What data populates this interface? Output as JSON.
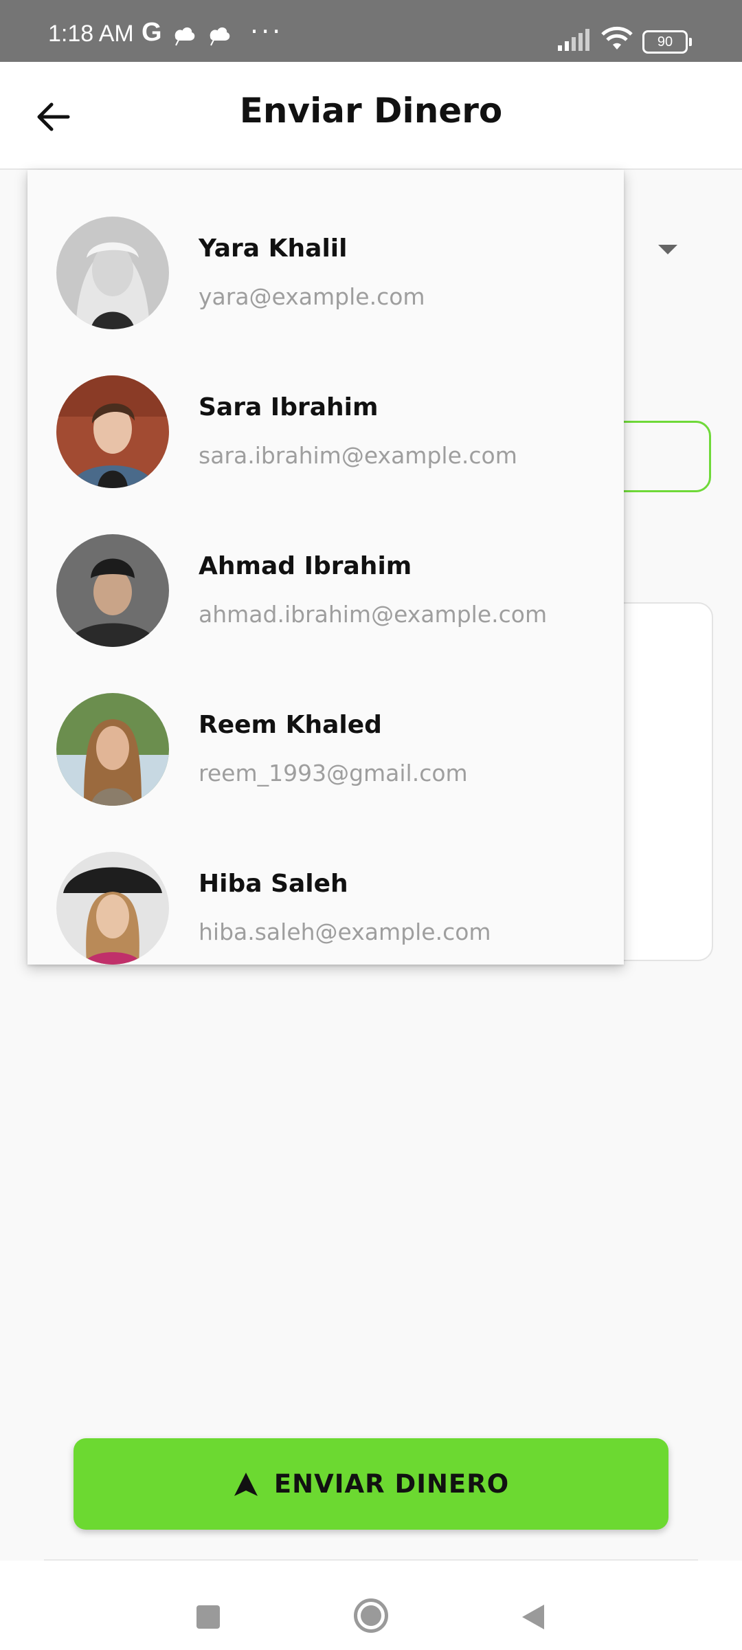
{
  "status_bar": {
    "time": "1:18 AM",
    "carrier_icon": "G",
    "more": "···",
    "battery": "90"
  },
  "app_bar": {
    "title": "Enviar Dinero",
    "back_icon": "arrow-left-icon"
  },
  "contacts": [
    {
      "name": "Yara Khalil",
      "email": "yara@example.com"
    },
    {
      "name": "Sara Ibrahim",
      "email": "sara.ibrahim@example.com"
    },
    {
      "name": "Ahmad Ibrahim",
      "email": "ahmad.ibrahim@example.com"
    },
    {
      "name": "Reem Khaled",
      "email": "reem_1993@gmail.com"
    },
    {
      "name": "Hiba Saleh",
      "email": "hiba.saleh@example.com"
    }
  ],
  "send_button": {
    "label": "ENVIAR DINERO",
    "icon": "send-arrow-icon"
  },
  "colors": {
    "accent": "#6cd931",
    "status_bar": "#757575"
  }
}
